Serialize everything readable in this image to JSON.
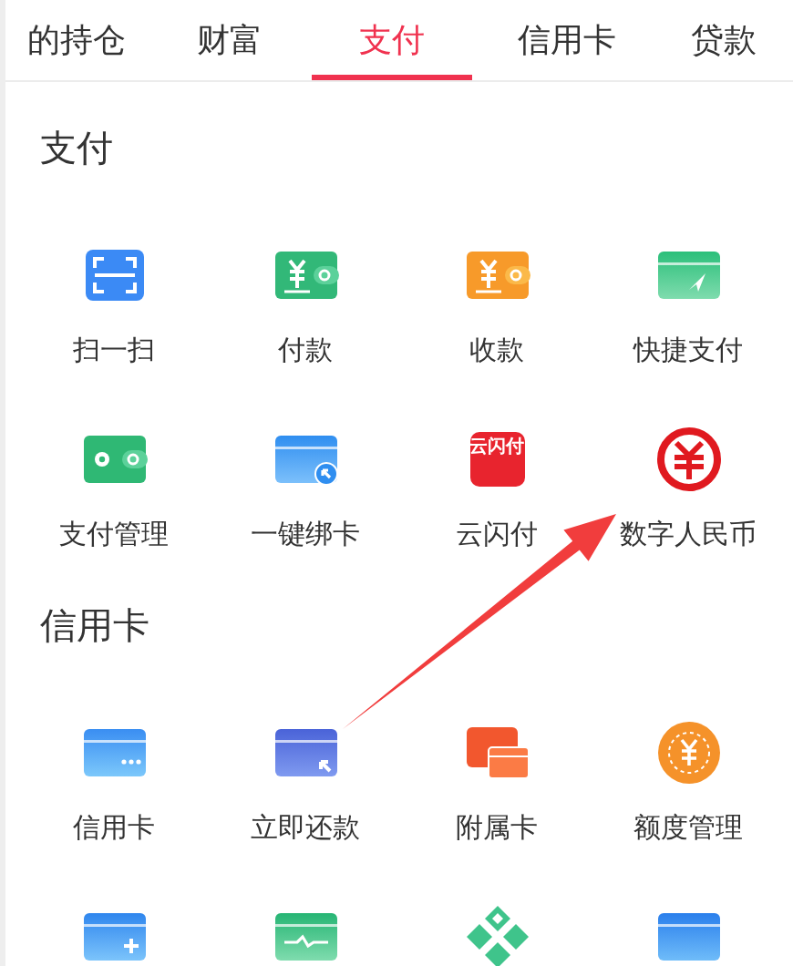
{
  "tabs": [
    {
      "label": "的持仓",
      "selected": false
    },
    {
      "label": "财富",
      "selected": false
    },
    {
      "label": "支付",
      "selected": true
    },
    {
      "label": "信用卡",
      "selected": false
    },
    {
      "label": "贷款",
      "selected": false
    }
  ],
  "sections": [
    {
      "title": "支付",
      "items": [
        {
          "kind": "tile",
          "label": "扫一扫"
        },
        {
          "kind": "tile",
          "label": "付款"
        },
        {
          "kind": "tile",
          "label": "收款"
        },
        {
          "kind": "tile",
          "label": "快捷支付"
        },
        {
          "kind": "tile",
          "label": "支付管理"
        },
        {
          "kind": "tile",
          "label": "一键绑卡"
        },
        {
          "kind": "logo_tile",
          "label": "云闪付",
          "logo_text": "云闪付"
        },
        {
          "kind": "tile",
          "label": "数字人民币"
        }
      ]
    },
    {
      "title": "信用卡",
      "items": [
        {
          "kind": "tile",
          "label": "信用卡"
        },
        {
          "kind": "tile",
          "label": "立即还款"
        },
        {
          "kind": "tile",
          "label": "附属卡"
        },
        {
          "kind": "tile",
          "label": "额度管理"
        },
        {
          "kind": "icon_only"
        },
        {
          "kind": "icon_only"
        },
        {
          "kind": "icon_only"
        },
        {
          "kind": "icon_only"
        }
      ]
    }
  ]
}
